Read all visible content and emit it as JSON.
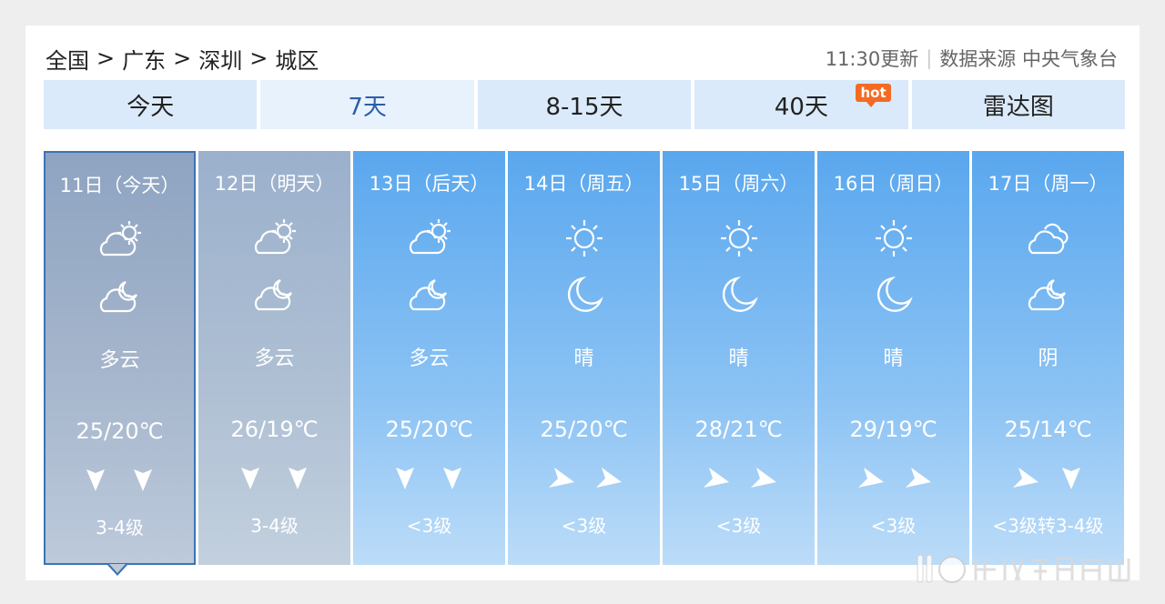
{
  "breadcrumb": [
    "全国",
    "广东",
    "深圳",
    "城区"
  ],
  "breadcrumb_sep": ">",
  "meta": {
    "update_time": "11:30更新",
    "source_label": "数据来源 中央气象台"
  },
  "tabs": [
    {
      "label": "今天"
    },
    {
      "label": "7天",
      "active": true
    },
    {
      "label": "8-15天"
    },
    {
      "label": "40天",
      "badge": "hot"
    },
    {
      "label": "雷达图"
    }
  ],
  "days": [
    {
      "date": "11日（今天）",
      "day_icon": "cloudy-sun-icon",
      "night_icon": "cloudy-moon-icon",
      "condition": "多云",
      "temp": "25/20℃",
      "winds": [
        "wind-down-icon",
        "wind-down-icon"
      ],
      "wind_level": "3-4级"
    },
    {
      "date": "12日（明天）",
      "day_icon": "cloudy-sun-icon",
      "night_icon": "cloudy-moon-icon",
      "condition": "多云",
      "temp": "26/19℃",
      "winds": [
        "wind-down-icon",
        "wind-down-icon"
      ],
      "wind_level": "3-4级"
    },
    {
      "date": "13日（后天）",
      "day_icon": "cloudy-sun-icon",
      "night_icon": "cloudy-moon-icon",
      "condition": "多云",
      "temp": "25/20℃",
      "winds": [
        "wind-down-icon",
        "wind-down-icon"
      ],
      "wind_level": "<3级"
    },
    {
      "date": "14日（周五）",
      "day_icon": "sun-icon",
      "night_icon": "moon-icon",
      "condition": "晴",
      "temp": "25/20℃",
      "winds": [
        "wind-right-icon",
        "wind-right-icon"
      ],
      "wind_level": "<3级"
    },
    {
      "date": "15日（周六）",
      "day_icon": "sun-icon",
      "night_icon": "moon-icon",
      "condition": "晴",
      "temp": "28/21℃",
      "winds": [
        "wind-right-icon",
        "wind-right-icon"
      ],
      "wind_level": "<3级"
    },
    {
      "date": "16日（周日）",
      "day_icon": "sun-icon",
      "night_icon": "moon-icon",
      "condition": "晴",
      "temp": "29/19℃",
      "winds": [
        "wind-right-icon",
        "wind-right-icon"
      ],
      "wind_level": "<3级"
    },
    {
      "date": "17日（周一）",
      "day_icon": "overcast-icon",
      "night_icon": "cloudy-moon-icon",
      "condition": "阴",
      "temp": "25/14℃",
      "winds": [
        "wind-right-icon",
        "wind-down-icon"
      ],
      "wind_level": "<3级转3-4级"
    }
  ],
  "colors": {
    "future_day_top": "#5aa7ee",
    "past_day_top": "#9bb0cc",
    "tab_bg": "#dbeafb",
    "active_tab_text": "#2b5fa8",
    "hot_badge": "#f56a22"
  }
}
